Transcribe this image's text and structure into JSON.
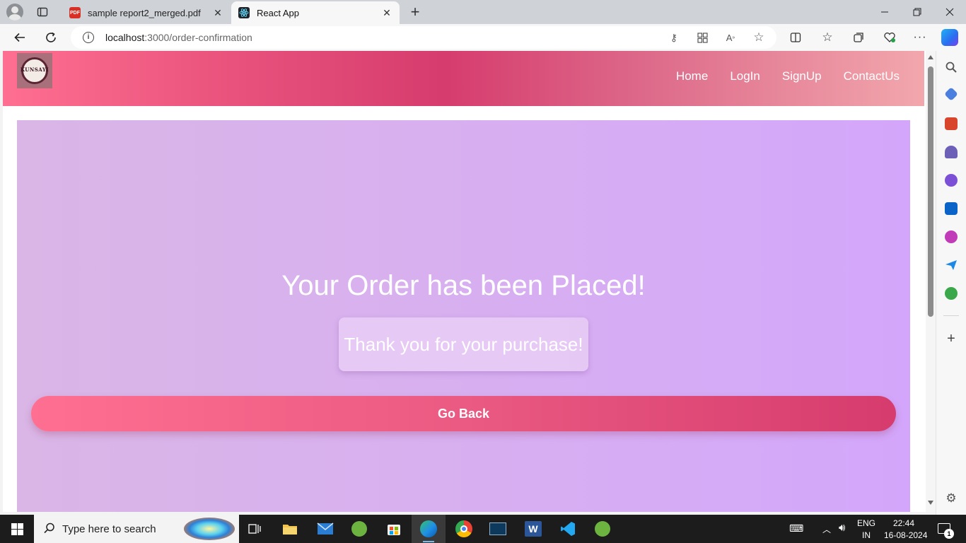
{
  "browser": {
    "tabs": [
      {
        "title": "sample report2_merged.pdf",
        "favicon": "pdf-icon",
        "active": false
      },
      {
        "title": "React App",
        "favicon": "react-icon",
        "active": true
      }
    ],
    "url_host": "localhost",
    "url_path": ":3000/order-confirmation"
  },
  "site": {
    "logo_text": "KUNSAYI",
    "nav": [
      "Home",
      "LogIn",
      "SignUp",
      "ContactUs"
    ],
    "header_gradient": [
      "#ff6f91",
      "#d63c6e",
      "#f2a7ad"
    ]
  },
  "confirmation": {
    "title": "Your Order has been Placed!",
    "message": "Thank you for your purchase!",
    "button_label": "Go Back",
    "card_colors": [
      "#d9b6e6",
      "#d3a6fb"
    ]
  },
  "taskbar": {
    "search_placeholder": "Type here to search",
    "language": "ENG",
    "region": "IN",
    "time": "22:44",
    "date": "16-08-2024",
    "notification_count": "1"
  }
}
